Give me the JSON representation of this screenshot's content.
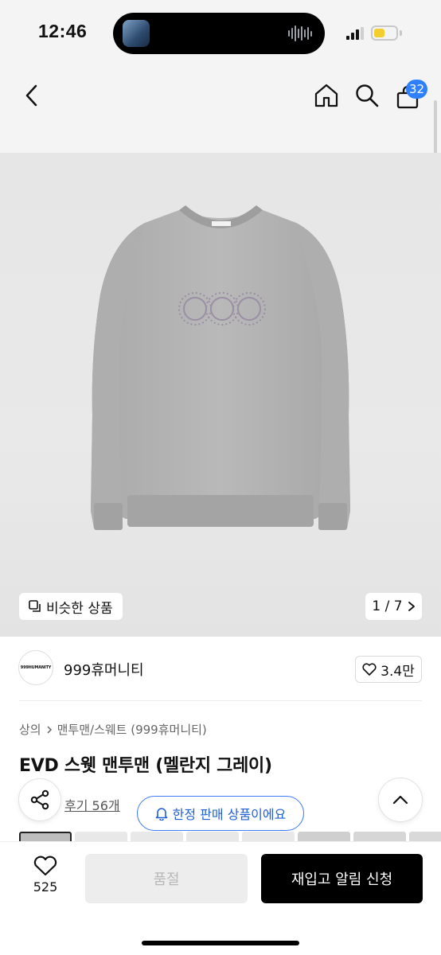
{
  "status_bar": {
    "time": "12:46",
    "battery_level": 0.5,
    "battery_color": "#f2cf2e"
  },
  "nav": {
    "back_icon": "chevron-left-icon",
    "home_icon": "home-icon",
    "search_icon": "search-icon",
    "cart_icon": "shopping-bag-icon",
    "cart_count": "32",
    "badge_color": "#2f80ff"
  },
  "product_image": {
    "similar_label": "비슷한 상품",
    "counter": "1 / 7",
    "print_text": "999"
  },
  "brand": {
    "logo_text": "999HUMANITY",
    "name": "999휴머니티",
    "likes": "3.4만"
  },
  "breadcrumb": {
    "level1": "상의",
    "level2": "맨투맨/스웨트 (999휴머니티)"
  },
  "product": {
    "title": "EVD 스웻 맨투맨 (멜란지 그레이)"
  },
  "review": {
    "link": "후기 56개",
    "limited_label": "한정 판매 상품이에요"
  },
  "bottom_bar": {
    "wish_count": "525",
    "soldout_label": "품절",
    "restock_label": "재입고 알림 신청"
  },
  "colors": {
    "accent_blue": "#3d7bf7",
    "primary_black": "#000000"
  }
}
